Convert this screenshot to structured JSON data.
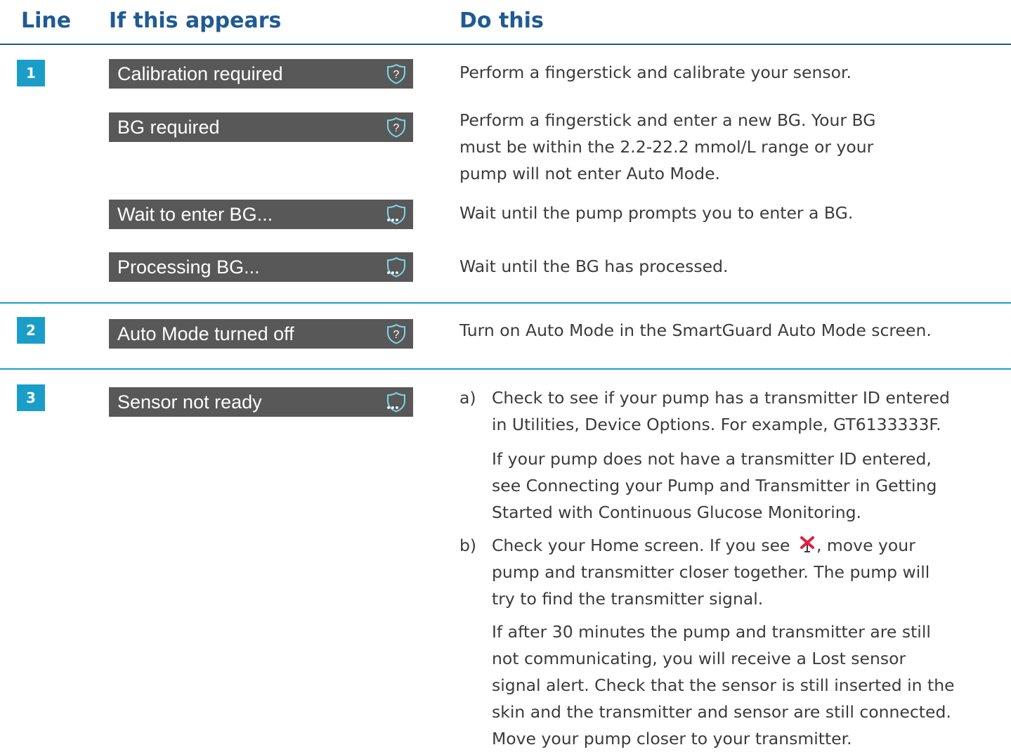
{
  "header": {
    "col_line": "Line",
    "col_appears": "If this appears",
    "col_do": "Do this"
  },
  "icons": {
    "help": "shield-question-icon",
    "wait": "shield-dots-icon",
    "no_signal": "antenna-red-x-icon"
  },
  "colors": {
    "heading": "#1f5a93",
    "accent": "#1a9ec9",
    "bar": "#585858",
    "body_text": "#3b3b3b",
    "alert_red": "#e0213b"
  },
  "rows": [
    {
      "number": "1",
      "items": [
        {
          "message": "Calibration required",
          "icon": "help",
          "action": "Perform a fingerstick and calibrate your sensor."
        },
        {
          "message": "BG required",
          "icon": "help",
          "action_lines": [
            "Perform a fingerstick and enter a new BG. Your BG",
            "must be within the 2.2-22.2 mmol/L range or your",
            "pump will not enter Auto Mode."
          ]
        },
        {
          "message": "Wait to enter BG...",
          "icon": "wait",
          "action": "Wait until the pump prompts you to enter a BG."
        },
        {
          "message": "Processing BG...",
          "icon": "wait",
          "action": "Wait until the BG has processed."
        }
      ]
    },
    {
      "number": "2",
      "items": [
        {
          "message": "Auto Mode turned off",
          "icon": "help",
          "action": "Turn on Auto Mode in the SmartGuard Auto Mode screen."
        }
      ]
    },
    {
      "number": "3",
      "items": [
        {
          "message": "Sensor not ready",
          "icon": "wait",
          "steps": [
            {
              "marker": "a)",
              "lines": [
                "Check to see if your pump has a transmitter ID entered",
                "in Utilities, Device Options. For example, GT6133333F."
              ],
              "note_lines": [
                "If your pump does not have a transmitter ID entered,",
                "see Connecting your Pump and Transmitter in Getting",
                "Started with Continuous Glucose Monitoring."
              ]
            },
            {
              "marker": "b)",
              "line1_before": "Check your Home screen. If you see",
              "line1_after": ", move your",
              "lines": [
                "pump and transmitter closer together. The pump will",
                "try to find the transmitter signal."
              ],
              "note_lines": [
                "If after 30 minutes the pump and transmitter are still",
                "not communicating, you will receive a Lost sensor",
                "signal alert. Check that the sensor is still inserted in the",
                "skin and the transmitter and sensor are still connected.",
                "Move your pump closer to your transmitter."
              ]
            }
          ]
        }
      ]
    }
  ]
}
